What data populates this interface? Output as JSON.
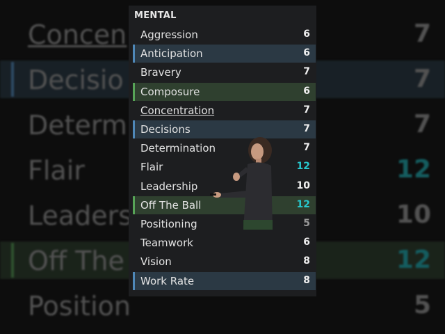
{
  "panel": {
    "title": "MENTAL",
    "attributes": [
      {
        "label": "Aggression",
        "value": "6",
        "highlight": "none",
        "underline": false,
        "value_style": "normal"
      },
      {
        "label": "Anticipation",
        "value": "6",
        "highlight": "blue",
        "underline": false,
        "value_style": "normal"
      },
      {
        "label": "Bravery",
        "value": "7",
        "highlight": "none",
        "underline": false,
        "value_style": "normal"
      },
      {
        "label": "Composure",
        "value": "6",
        "highlight": "green",
        "underline": false,
        "value_style": "normal"
      },
      {
        "label": "Concentration",
        "value": "7",
        "highlight": "none",
        "underline": true,
        "value_style": "normal"
      },
      {
        "label": "Decisions",
        "value": "7",
        "highlight": "blue",
        "underline": false,
        "value_style": "normal"
      },
      {
        "label": "Determination",
        "value": "7",
        "highlight": "none",
        "underline": false,
        "value_style": "normal"
      },
      {
        "label": "Flair",
        "value": "12",
        "highlight": "none",
        "underline": false,
        "value_style": "cyan"
      },
      {
        "label": "Leadership",
        "value": "10",
        "highlight": "none",
        "underline": false,
        "value_style": "normal"
      },
      {
        "label": "Off The Ball",
        "value": "12",
        "highlight": "green",
        "underline": false,
        "value_style": "cyan"
      },
      {
        "label": "Positioning",
        "value": "5",
        "highlight": "none",
        "underline": false,
        "value_style": "dim"
      },
      {
        "label": "Teamwork",
        "value": "6",
        "highlight": "none",
        "underline": false,
        "value_style": "normal"
      },
      {
        "label": "Vision",
        "value": "8",
        "highlight": "none",
        "underline": false,
        "value_style": "normal"
      },
      {
        "label": "Work Rate",
        "value": "8",
        "highlight": "blue",
        "underline": false,
        "value_style": "normal"
      }
    ]
  },
  "background_rows": [
    {
      "label": "Concen",
      "value": "7",
      "highlight": "none",
      "underline": true,
      "value_style": "normal"
    },
    {
      "label": "Decisio",
      "value": "7",
      "highlight": "blue",
      "underline": false,
      "value_style": "normal"
    },
    {
      "label": "Determ",
      "value": "7",
      "highlight": "none",
      "underline": false,
      "value_style": "normal"
    },
    {
      "label": "Flair",
      "value": "12",
      "highlight": "none",
      "underline": false,
      "value_style": "cyan"
    },
    {
      "label": "Leaders",
      "value": "10",
      "highlight": "none",
      "underline": false,
      "value_style": "normal"
    },
    {
      "label": "Off The",
      "value": "12",
      "highlight": "green",
      "underline": false,
      "value_style": "cyan"
    },
    {
      "label": "Position",
      "value": "5",
      "highlight": "none",
      "underline": false,
      "value_style": "normal"
    }
  ],
  "colors": {
    "panel_bg": "#1d1e20",
    "row_blue": "#2b3944",
    "row_green": "#2f402f",
    "accent_blue": "#4f88b8",
    "accent_green": "#57a457",
    "value_cyan": "#27c9cf"
  },
  "icons": {
    "presenter": "presenter-silhouette"
  }
}
